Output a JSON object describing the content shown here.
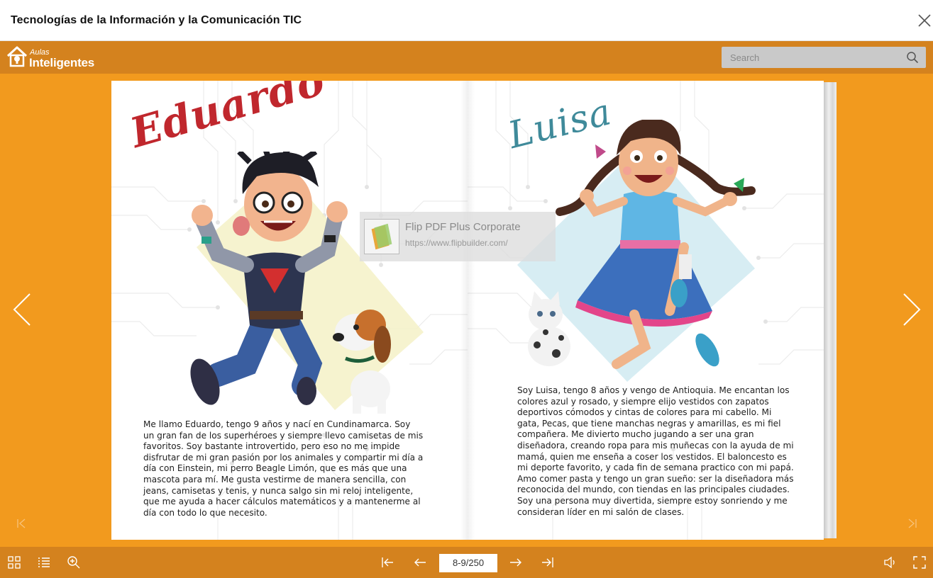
{
  "window": {
    "title": "Tecnologías de la Información y la Comunicación TIC"
  },
  "brand": {
    "small": "Aulas",
    "big": "Inteligentes"
  },
  "search": {
    "placeholder": "Search"
  },
  "pages": {
    "left": {
      "heading": "Eduardo",
      "body": "Me llamo Eduardo, tengo 9 años y nací en Cundinamarca. Soy un gran fan de los superhéroes y siempre llevo camisetas de mis favoritos. Soy bastante introvertido, pero eso no me impide disfrutar de mi gran pasión por los animales y compartir mi día a día con Einstein, mi perro Beagle Limón, que es más que una mascota para mí. Me gusta vestirme de manera sencilla, con jeans, camisetas y tenis, y nunca salgo sin mi reloj inteligente, que me ayuda a hacer cálculos matemáticos y a mantenerme al día con todo lo que necesito."
    },
    "right": {
      "heading": "Luisa",
      "body": "Soy Luisa, tengo 8 años y vengo de Antioquia. Me encantan los colores azul y rosado, y siempre elijo vestidos con zapatos deportivos cómodos y cintas de colores para mi cabello. Mi gata, Pecas, que tiene manchas negras y amarillas, es mi fiel compañera. Me divierto mucho jugando a ser una gran diseñadora, creando ropa para mis muñecas con la ayuda de mi mamá, quien me enseña a coser los vestidos. El baloncesto es mi deporte favorito, y cada fin de semana practico con mi papá. Amo comer pasta y tengo un gran sueño: ser la diseñadora más reconocida del mundo, con tiendas en las principales ciudades. Soy una persona muy divertida, siempre estoy sonriendo y me consideran líder en mi salón de clases."
    }
  },
  "watermark": {
    "name": "Flip PDF Plus Corporate",
    "url": "https://www.flipbuilder.com/"
  },
  "pager": {
    "current": "8-9/250"
  },
  "colors": {
    "background": "#f29a1e",
    "toolbar": "#d4821e",
    "eduardo_title": "#c0272d",
    "luisa_title": "#3f8a9a"
  },
  "icons": {
    "thumbnails": "grid-icon",
    "toc": "list-icon",
    "zoom": "zoom-in-icon",
    "first": "first-page-icon",
    "prev": "previous-page-icon",
    "next": "next-page-icon",
    "last": "last-page-icon",
    "sound": "speaker-icon",
    "fullscreen": "fullscreen-icon"
  }
}
